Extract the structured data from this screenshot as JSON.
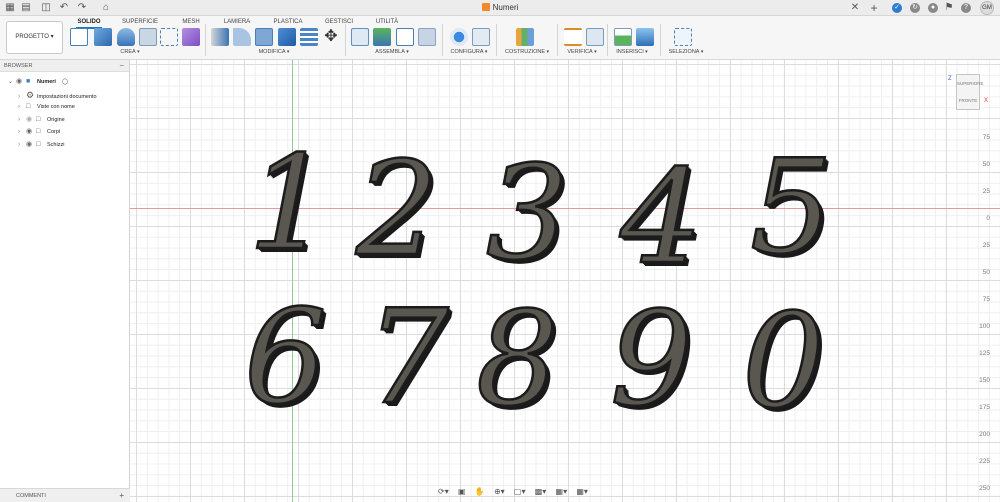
{
  "document": {
    "title": "Numeri"
  },
  "titlebar": {
    "user_initials": "GM"
  },
  "toolbar": {
    "workspace_label": "PROGETTO",
    "tabs": [
      {
        "label": "SOLIDO",
        "active": true
      },
      {
        "label": "SUPERFICIE"
      },
      {
        "label": "MESH"
      },
      {
        "label": "LAMIERA"
      },
      {
        "label": "PLASTICA"
      },
      {
        "label": "GESTISCI"
      },
      {
        "label": "UTILITÀ"
      }
    ],
    "groups": [
      "CREA",
      "MODIFICA",
      "ASSEMBLA",
      "CONFIGURA",
      "COSTRUZIONE",
      "VERIFICA",
      "INSERISCI",
      "SELEZIONA"
    ]
  },
  "browser": {
    "header": "BROWSER",
    "items": [
      {
        "label": "Numeri",
        "icon": "component-icon"
      },
      {
        "label": "Impostazioni documento",
        "icon": "gear-icon"
      },
      {
        "label": "Viste con nome",
        "icon": "folder-icon"
      },
      {
        "label": "Origine",
        "icon": "folder-icon"
      },
      {
        "label": "Corpi",
        "icon": "folder-icon"
      },
      {
        "label": "Schizzi",
        "icon": "folder-icon"
      }
    ]
  },
  "comments": {
    "label": "COMMENTI"
  },
  "viewcube": {
    "top": "SUPERIORE",
    "front": "FRONTE",
    "axis_x": "X",
    "axis_z": "Z"
  },
  "ruler": {
    "labels": [
      "75",
      "50",
      "25",
      "0",
      "25",
      "50",
      "75",
      "100",
      "125",
      "150",
      "175",
      "200",
      "225",
      "250"
    ]
  },
  "canvas": {
    "digits_row1": [
      "1",
      "2",
      "3",
      "4",
      "5"
    ],
    "digits_row2": [
      "6",
      "7",
      "8",
      "9",
      "0"
    ]
  },
  "colors": {
    "accent": "#1a7bc4",
    "solid_fill": "#5a5650",
    "x_axis": "#e39a9a",
    "y_axis": "#8fd08f"
  }
}
